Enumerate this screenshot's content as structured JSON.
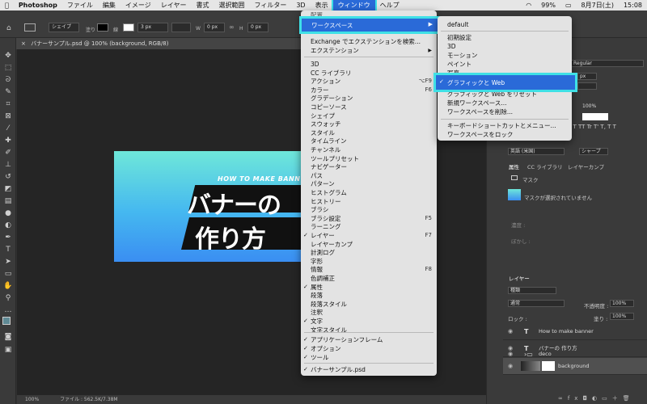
{
  "menubar": {
    "apple": "",
    "items": [
      "Photoshop",
      "ファイル",
      "編集",
      "イメージ",
      "レイヤー",
      "書式",
      "選択範囲",
      "フィルター",
      "3D",
      "表示",
      "ウィンドウ",
      "ヘルプ"
    ],
    "active": "ウィンドウ",
    "status": {
      "battery": "99%",
      "date": "8月7日(土)",
      "time": "15:08"
    }
  },
  "options": {
    "shape_mode": "シェイプ",
    "fill_label": "塗り",
    "stroke_label": "線",
    "stroke_size": "3 px",
    "w_label": "W",
    "w_value": "0 px",
    "h_label": "H",
    "h_value": "0 px"
  },
  "doc_tab": {
    "title": "バナーサンプル.psd @ 100% (background, RGB/8)"
  },
  "banner": {
    "subtitle": "HOW TO MAKE BANN",
    "line1": "バナーの",
    "line2": "作り方"
  },
  "statusbar": {
    "zoom": "100%",
    "file": "ファイル : 562.5K/7.38M"
  },
  "window_menu": {
    "top_hidden": "配置",
    "workspace": "ワークスペース",
    "exchange": "Exchange でエクステンションを検索...",
    "extension": "エクステンション",
    "items": [
      {
        "label": "3D",
        "check": false,
        "shortcut": ""
      },
      {
        "label": "CC ライブラリ",
        "check": false,
        "shortcut": ""
      },
      {
        "label": "アクション",
        "check": false,
        "shortcut": "⌥F9"
      },
      {
        "label": "カラー",
        "check": false,
        "shortcut": "F6"
      },
      {
        "label": "グラデーション",
        "check": false,
        "shortcut": ""
      },
      {
        "label": "コピーソース",
        "check": false,
        "shortcut": ""
      },
      {
        "label": "シェイプ",
        "check": false,
        "shortcut": ""
      },
      {
        "label": "スウォッチ",
        "check": false,
        "shortcut": ""
      },
      {
        "label": "スタイル",
        "check": false,
        "shortcut": ""
      },
      {
        "label": "タイムライン",
        "check": false,
        "shortcut": ""
      },
      {
        "label": "チャンネル",
        "check": false,
        "shortcut": ""
      },
      {
        "label": "ツールプリセット",
        "check": false,
        "shortcut": ""
      },
      {
        "label": "ナビゲーター",
        "check": false,
        "shortcut": ""
      },
      {
        "label": "パス",
        "check": false,
        "shortcut": ""
      },
      {
        "label": "パターン",
        "check": false,
        "shortcut": ""
      },
      {
        "label": "ヒストグラム",
        "check": false,
        "shortcut": ""
      },
      {
        "label": "ヒストリー",
        "check": false,
        "shortcut": ""
      },
      {
        "label": "ブラシ",
        "check": false,
        "shortcut": ""
      },
      {
        "label": "ブラシ設定",
        "check": false,
        "shortcut": "F5"
      },
      {
        "label": "ラーニング",
        "check": false,
        "shortcut": ""
      },
      {
        "label": "レイヤー",
        "check": true,
        "shortcut": "F7"
      },
      {
        "label": "レイヤーカンプ",
        "check": false,
        "shortcut": ""
      },
      {
        "label": "計測ログ",
        "check": false,
        "shortcut": ""
      },
      {
        "label": "字形",
        "check": false,
        "shortcut": ""
      },
      {
        "label": "情報",
        "check": false,
        "shortcut": "F8"
      },
      {
        "label": "色調補正",
        "check": false,
        "shortcut": ""
      },
      {
        "label": "属性",
        "check": true,
        "shortcut": ""
      },
      {
        "label": "段落",
        "check": false,
        "shortcut": ""
      },
      {
        "label": "段落スタイル",
        "check": false,
        "shortcut": ""
      },
      {
        "label": "注釈",
        "check": false,
        "shortcut": ""
      },
      {
        "label": "文字",
        "check": true,
        "shortcut": ""
      },
      {
        "label": "文字スタイル",
        "check": false,
        "shortcut": ""
      }
    ],
    "bottom": [
      {
        "label": "アプリケーションフレーム",
        "check": true
      },
      {
        "label": "オプション",
        "check": true
      },
      {
        "label": "ツール",
        "check": true
      }
    ],
    "document": {
      "label": "バナーサンプル.psd",
      "check": true
    }
  },
  "workspace_submenu": {
    "items_a": [
      "default"
    ],
    "items_b": [
      "初期設定",
      "3D",
      "モーション",
      "ペイント",
      "写真"
    ],
    "selected": "グラフィックと Web",
    "items_c": [
      "グラフィックと Web をリセット",
      "新規ワークスペース...",
      "ワークスペースを削除..."
    ],
    "items_d": [
      "キーボードショートカットとメニュー...",
      "ワークスペースをロック"
    ]
  },
  "right_panel": {
    "font_style": "Regular",
    "font_size": "px",
    "tracking": "100%",
    "language": "英語 (米国)",
    "aa": "シャープ",
    "tabs1": [
      "属性",
      "CC ライブラリ",
      "レイヤーカンプ"
    ],
    "mask_label": "マスク",
    "mask_msg": "マスクが選択されていません",
    "density_label": "濃度 :",
    "feather_label": "ぼかし :",
    "layers_tab": "レイヤー",
    "kind": "種類",
    "blend": "通常",
    "opacity_label": "不透明度 :",
    "opacity": "100%",
    "lock_label": "ロック :",
    "fill_label": "塗り :",
    "fill": "100%",
    "layers": [
      {
        "type": "T",
        "name": "How to make banner"
      },
      {
        "type": "T",
        "name": "バナーの 作り方"
      },
      {
        "type": "folder",
        "name": "deco"
      },
      {
        "type": "img",
        "name": "background"
      }
    ]
  },
  "colors": {
    "accent": "#2a6ad8",
    "highlight": "#3fe0e6"
  }
}
